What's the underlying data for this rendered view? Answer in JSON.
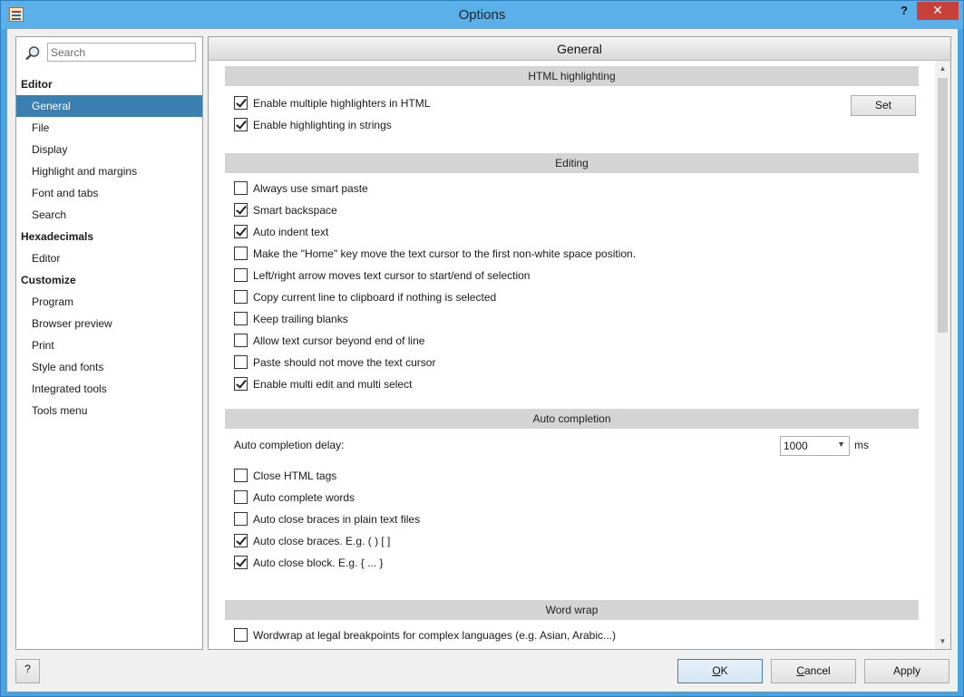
{
  "window": {
    "title": "Options",
    "help_label": "?",
    "close_label": "✕"
  },
  "nav": {
    "search_placeholder": "Search",
    "groups": [
      {
        "header": "Editor",
        "items": [
          "General",
          "File",
          "Display",
          "Highlight and margins",
          "Font and tabs",
          "Search"
        ]
      },
      {
        "header": "Hexadecimals",
        "items": [
          "Editor"
        ]
      },
      {
        "header": "Customize",
        "items": [
          "Program",
          "Browser preview",
          "Print",
          "Style and fonts",
          "Integrated tools",
          "Tools menu"
        ]
      }
    ],
    "selected": "General"
  },
  "panel": {
    "title": "General",
    "sections": {
      "html": {
        "title": "HTML highlighting"
      },
      "editing": {
        "title": "Editing"
      },
      "auto": {
        "title": "Auto completion"
      },
      "wrap": {
        "title": "Word wrap"
      }
    },
    "set_button": "Set",
    "options": {
      "multi_highlighters": {
        "label": "Enable multiple highlighters in HTML",
        "checked": true
      },
      "highlight_strings": {
        "label": "Enable highlighting in strings",
        "checked": true
      },
      "smart_paste": {
        "label": "Always use smart paste",
        "checked": false
      },
      "smart_backspace": {
        "label": "Smart backspace",
        "checked": true
      },
      "auto_indent": {
        "label": "Auto indent text",
        "checked": true
      },
      "home_key": {
        "label": "Make the \"Home\" key move the text cursor to the first non-white space position.",
        "checked": false
      },
      "arrow_moves": {
        "label": "Left/right arrow moves text cursor to start/end of selection",
        "checked": false
      },
      "copy_line": {
        "label": "Copy current line to clipboard if nothing is selected",
        "checked": false
      },
      "trailing_blanks": {
        "label": "Keep trailing blanks",
        "checked": false
      },
      "cursor_beyond": {
        "label": "Allow text cursor beyond end of line",
        "checked": false
      },
      "paste_no_move": {
        "label": "Paste should not move the text cursor",
        "checked": false
      },
      "multi_edit": {
        "label": "Enable multi edit and multi select",
        "checked": true
      },
      "close_html": {
        "label": "Close HTML tags",
        "checked": false
      },
      "complete_words": {
        "label": "Auto complete words",
        "checked": false
      },
      "braces_plain": {
        "label": "Auto close braces in plain text files",
        "checked": false
      },
      "close_braces": {
        "label": "Auto close braces. E.g. ( ) [ ]",
        "checked": true
      },
      "close_block": {
        "label": "Auto close block. E.g. { ... }",
        "checked": true
      },
      "wordwrap_legal": {
        "label": "Wordwrap at legal breakpoints for complex languages (e.g. Asian, Arabic...)",
        "checked": false
      }
    },
    "delay": {
      "label": "Auto completion delay:",
      "value": "1000",
      "unit": "ms"
    }
  },
  "footer": {
    "help": "?",
    "ok_key": "O",
    "ok_rest": "K",
    "cancel_key": "C",
    "cancel_rest": "ancel",
    "apply": "Apply"
  }
}
